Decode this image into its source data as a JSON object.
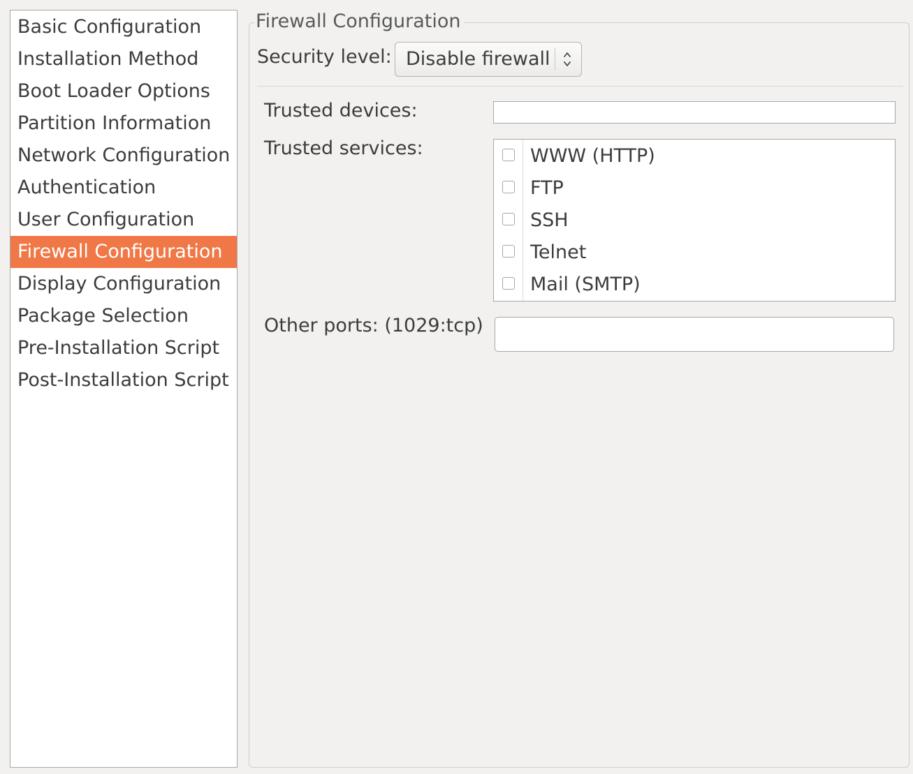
{
  "sidebar": {
    "items": [
      {
        "label": "Basic Configuration",
        "selected": false
      },
      {
        "label": "Installation Method",
        "selected": false
      },
      {
        "label": "Boot Loader Options",
        "selected": false
      },
      {
        "label": "Partition Information",
        "selected": false
      },
      {
        "label": "Network Configuration",
        "selected": false
      },
      {
        "label": "Authentication",
        "selected": false
      },
      {
        "label": "User Configuration",
        "selected": false
      },
      {
        "label": "Firewall Configuration",
        "selected": true
      },
      {
        "label": "Display Configuration",
        "selected": false
      },
      {
        "label": "Package Selection",
        "selected": false
      },
      {
        "label": "Pre-Installation Script",
        "selected": false
      },
      {
        "label": "Post-Installation Script",
        "selected": false
      }
    ],
    "selected_color": "#f07746"
  },
  "firewall": {
    "frame_title": "Firewall Configuration",
    "security_level_label": "Security level:",
    "security_level_value": "Disable firewall",
    "trusted_devices_label": "Trusted devices:",
    "trusted_devices_value": "",
    "trusted_services_label": "Trusted services:",
    "services": [
      {
        "label": "WWW (HTTP)",
        "checked": false
      },
      {
        "label": "FTP",
        "checked": false
      },
      {
        "label": "SSH",
        "checked": false
      },
      {
        "label": "Telnet",
        "checked": false
      },
      {
        "label": "Mail (SMTP)",
        "checked": false
      }
    ],
    "other_ports_label": "Other ports: (1029:tcp)",
    "other_ports_value": ""
  }
}
